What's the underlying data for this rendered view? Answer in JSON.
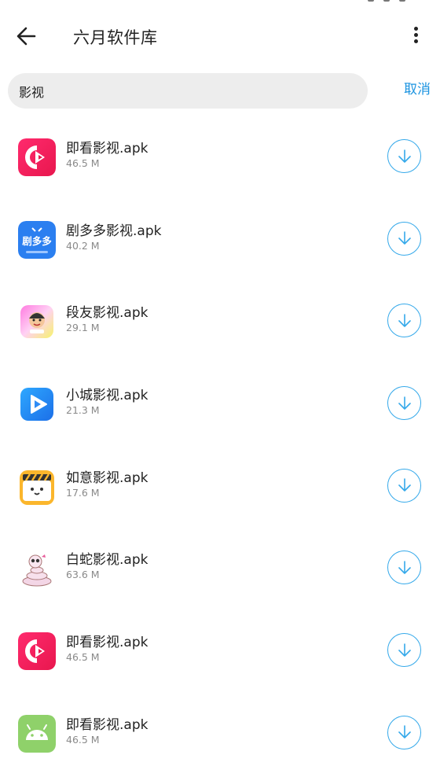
{
  "header": {
    "title": "六月软件库"
  },
  "search": {
    "value": "影视",
    "cancel_label": "取消"
  },
  "apps": [
    {
      "name": "即看影视.apk",
      "size": "46.5 M",
      "icon": "play-icon-pink"
    },
    {
      "name": "剧多多影视.apk",
      "size": "40.2 M",
      "icon": "juduoduo-icon",
      "icon_text": "剧多多"
    },
    {
      "name": "段友影视.apk",
      "size": "29.1 M",
      "icon": "cartoon-face-icon"
    },
    {
      "name": "小城影视.apk",
      "size": "21.3 M",
      "icon": "play-icon-blue"
    },
    {
      "name": "如意影视.apk",
      "size": "17.6 M",
      "icon": "clapperboard-icon"
    },
    {
      "name": "白蛇影视.apk",
      "size": "63.6 M",
      "icon": "snake-icon"
    },
    {
      "name": "即看影视.apk",
      "size": "46.5 M",
      "icon": "play-icon-pink"
    },
    {
      "name": "即看影视.apk",
      "size": "46.5 M",
      "icon": "android-icon"
    }
  ],
  "colors": {
    "accent": "#1a93e0",
    "download_ring": "#35a9ea",
    "pink": "#f0215e",
    "blue": "#2f7df0",
    "android": "#8fd16a"
  }
}
